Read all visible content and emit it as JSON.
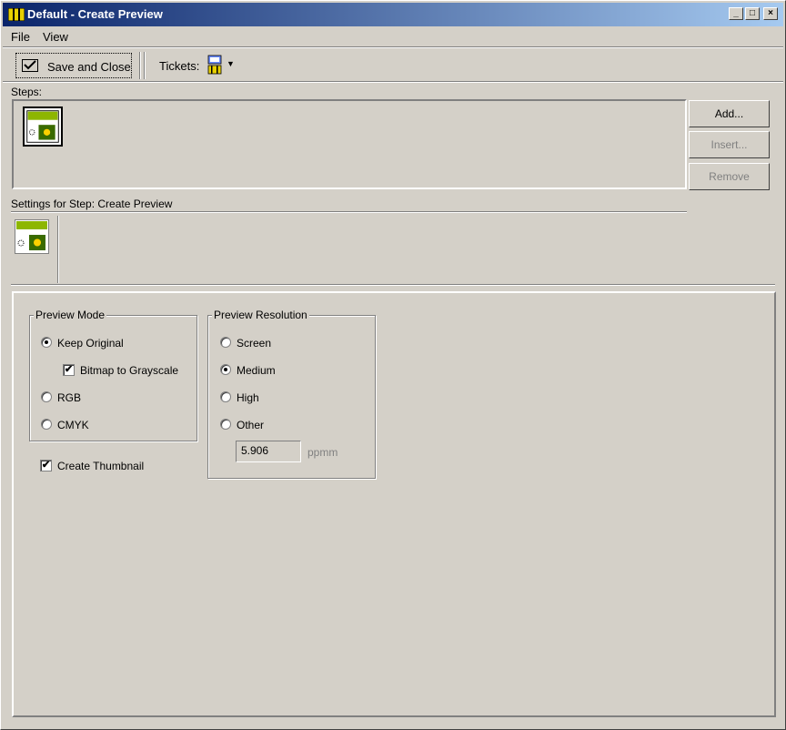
{
  "window": {
    "title": "Default - Create Preview",
    "controls": [
      "_",
      "□",
      "×"
    ]
  },
  "menu": {
    "items": [
      "File",
      "View"
    ]
  },
  "toolbar": {
    "save_label": "Save and Close",
    "tickets_label": "Tickets:"
  },
  "steps": {
    "label": "Steps:",
    "buttons": {
      "add": "Add...",
      "insert": "Insert...",
      "remove": "Remove"
    }
  },
  "settings": {
    "label": "Settings for Step: Create Preview",
    "preview_mode": {
      "title": "Preview Mode",
      "keep_original": "Keep Original",
      "bitmap_to_grayscale": "Bitmap to Grayscale",
      "rgb": "RGB",
      "cmyk": "CMYK",
      "selected": "Keep Original",
      "bitmap_checked": true
    },
    "create_thumbnail": {
      "label": "Create Thumbnail",
      "checked": true
    },
    "preview_resolution": {
      "title": "Preview Resolution",
      "screen": "Screen",
      "medium": "Medium",
      "high": "High",
      "other": "Other",
      "selected": "Medium",
      "other_value": "5.906",
      "unit": "ppmm"
    }
  },
  "colors": {
    "title_start": "#0a246a",
    "title_end": "#a6caf0",
    "icon_green": "#8db600",
    "surface": "#d4d0c8"
  }
}
